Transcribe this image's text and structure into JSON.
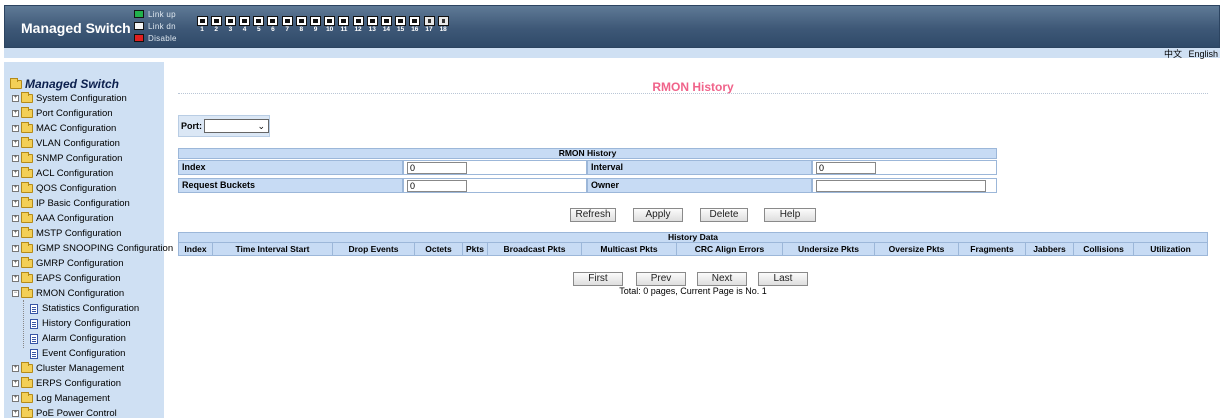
{
  "header": {
    "brand": "Managed Switch",
    "legend": [
      {
        "label": "Link up",
        "color": "#22b14c"
      },
      {
        "label": "Link dn",
        "color": "#f4f4f4"
      },
      {
        "label": "Disable",
        "color": "#e02020"
      }
    ],
    "ports": [
      "1",
      "2",
      "3",
      "4",
      "5",
      "6",
      "7",
      "8",
      "9",
      "10",
      "11",
      "12",
      "13",
      "14",
      "15",
      "16",
      "17",
      "18"
    ]
  },
  "languages": [
    "中文",
    "English"
  ],
  "sidebar": {
    "root": "Managed Switch",
    "items": [
      "System Configuration",
      "Port Configuration",
      "MAC Configuration",
      "VLAN Configuration",
      "SNMP Configuration",
      "ACL Configuration",
      "QOS Configuration",
      "IP Basic Configuration",
      "AAA Configuration",
      "MSTP Configuration",
      "IGMP SNOOPING Configuration",
      "GMRP Configuration",
      "EAPS Configuration",
      "RMON Configuration",
      "Cluster Management",
      "ERPS Configuration",
      "Log Management",
      "PoE Power Control"
    ],
    "rmon_children": [
      "Statistics Configuration",
      "History Configuration",
      "Alarm Configuration",
      "Event Configuration"
    ]
  },
  "page": {
    "title": "RMON History",
    "port_label": "Port:",
    "port_value": ""
  },
  "rmon_history": {
    "header": "RMON History",
    "index_label": "Index",
    "index_value": "0",
    "interval_label": "Interval",
    "interval_value": "0",
    "buckets_label": "Request Buckets",
    "buckets_value": "0",
    "owner_label": "Owner",
    "owner_value": ""
  },
  "actions": {
    "refresh": "Refresh",
    "apply": "Apply",
    "delete": "Delete",
    "help": "Help"
  },
  "history_data": {
    "header": "History Data",
    "columns": [
      "Index",
      "Time Interval Start",
      "Drop Events",
      "Octets",
      "Pkts",
      "Broadcast Pkts",
      "Multicast Pkts",
      "CRC Align Errors",
      "Undersize Pkts",
      "Oversize Pkts",
      "Fragments",
      "Jabbers",
      "Collisions",
      "Utilization"
    ]
  },
  "pager": {
    "first": "First",
    "prev": "Prev",
    "next": "Next",
    "last": "Last",
    "info": "Total: 0 pages, Current Page is No. 1"
  }
}
